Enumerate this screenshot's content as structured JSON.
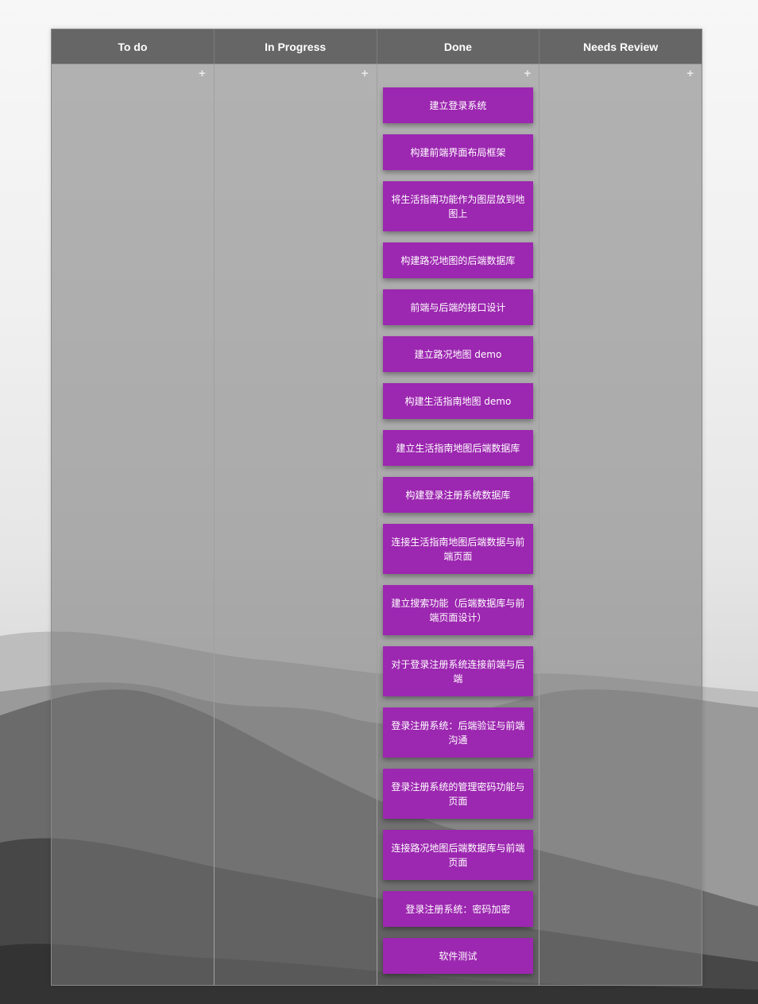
{
  "board": {
    "columns": [
      {
        "title": "To do",
        "add_icon": "+",
        "cards": []
      },
      {
        "title": "In Progress",
        "add_icon": "+",
        "cards": []
      },
      {
        "title": "Done",
        "add_icon": "+",
        "cards": [
          "建立登录系统",
          "构建前端界面布局框架",
          "将生活指南功能作为图层放到地图上",
          "构建路况地图的后端数据库",
          "前端与后端的接口设计",
          "建立路况地图 demo",
          "构建生活指南地图 demo",
          "建立生活指南地图后端数据库",
          "构建登录注册系统数据库",
          "连接生活指南地图后端数据与前端页面",
          "建立搜索功能（后端数据库与前端页面设计）",
          "对于登录注册系统连接前端与后端",
          "登录注册系统：后端验证与前端沟通",
          "登录注册系统的管理密码功能与页面",
          "连接路况地图后端数据库与前端页面",
          "登录注册系统：密码加密",
          "软件测试"
        ]
      },
      {
        "title": "Needs Review",
        "add_icon": "+",
        "cards": []
      }
    ]
  },
  "colors": {
    "header_bg": "#666666",
    "card_bg": "#9c27b0",
    "card_text": "#ffffff"
  }
}
